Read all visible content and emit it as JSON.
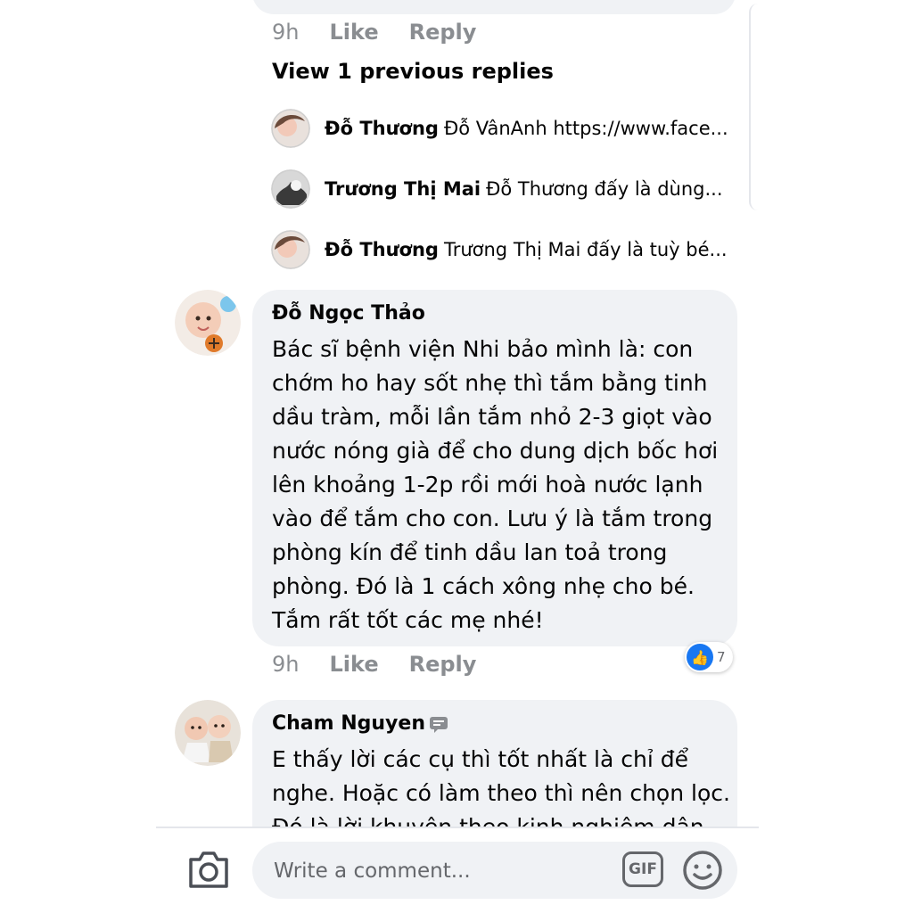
{
  "prev_comment_meta": {
    "time": "9h",
    "like": "Like",
    "reply": "Reply"
  },
  "view_previous": "View 1 previous replies",
  "replies": [
    {
      "author": "Đỗ Thương",
      "text": "Đỗ VânAnh  https://www.face..."
    },
    {
      "author": "Trương Thị Mai",
      "text": "Đỗ Thương  đấy là dùng..."
    },
    {
      "author": "Đỗ Thương",
      "text": "Trương Thị Mai  đấy là tuỳ bé..."
    }
  ],
  "comments": [
    {
      "author": "Đỗ Ngọc Thảo",
      "lines": [
        "Bác sĩ bệnh viện Nhi bảo mình là: con",
        "chớm ho hay sốt nhẹ thì tắm  bằng tinh",
        "dầu tràm, mỗi lần tắm nhỏ 2-3 giọt vào",
        "nước nóng già để cho dung dịch bốc hơi",
        "lên khoảng 1-2p rồi mới hoà nước lạnh",
        "vào để tắm cho con. Lưu ý là tắm trong",
        "phòng kín để tinh dầu lan toả trong",
        "phòng. Đó là 1 cách xông nhẹ cho bé.",
        "Tắm rất tốt các mẹ nhé!"
      ],
      "time": "9h",
      "like": "Like",
      "reply": "Reply",
      "reaction_icon": "like-icon",
      "reaction_count": "7"
    },
    {
      "author": "Cham Nguyen",
      "lines": [
        "E thấy lời các cụ thì tốt nhất là chỉ để",
        "nghe. Hoặc có làm theo thì nên chọn lọc.",
        "Đó là lời khuyên theo kinh nghiệm dân"
      ]
    }
  ],
  "composer": {
    "placeholder": "Write a comment...",
    "gif_label": "GIF"
  },
  "colors": {
    "bubble": "#f0f2f5",
    "meta": "#8a8d91",
    "like_blue": "#1877f2"
  }
}
